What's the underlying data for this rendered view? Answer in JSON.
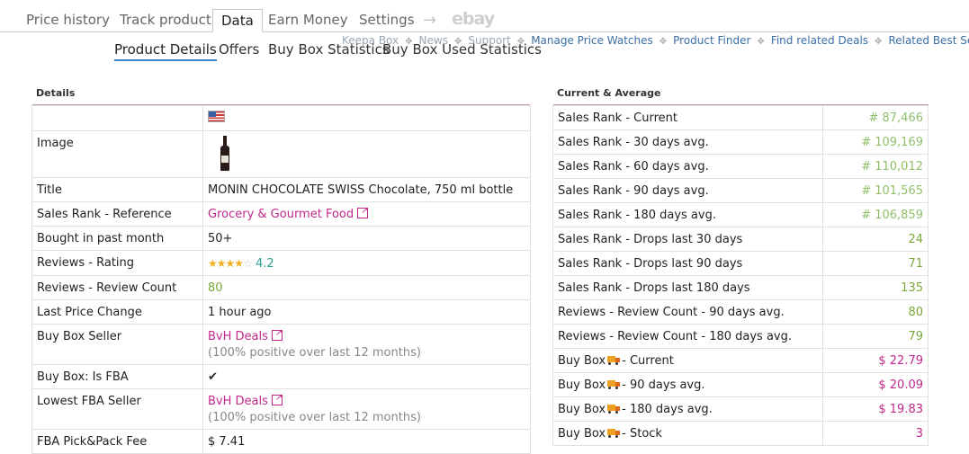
{
  "nav": {
    "tabs": [
      "Price history",
      "Track product",
      "Data",
      "Earn Money",
      "Settings"
    ],
    "arrow": "→",
    "ebay": "ebay"
  },
  "links": [
    "Keepa Box",
    "News",
    "Support",
    "Manage Price Watches",
    "Product Finder",
    "Find related Deals",
    "Related Best Sellers"
  ],
  "subtabs": [
    "Product Details",
    "Offers",
    "Buy Box Statistics",
    "Buy Box Used Statistics"
  ],
  "details": {
    "title": "Details",
    "image_label": "Image",
    "rows": {
      "title_label": "Title",
      "title_value": "MONIN CHOCOLATE SWISS Chocolate, 750 ml bottle",
      "rank_ref_label": "Sales Rank - Reference",
      "rank_ref_value": "Grocery & Gourmet Food",
      "bought_label": "Bought in past month",
      "bought_value": "50+",
      "rating_label": "Reviews - Rating",
      "rating_value": "4.2",
      "review_count_label": "Reviews - Review Count",
      "review_count_value": "80",
      "last_change_label": "Last Price Change",
      "last_change_value": "1 hour ago",
      "bb_seller_label": "Buy Box Seller",
      "bb_seller_value": "BvH Deals",
      "bb_seller_note": "(100% positive over last 12 months)",
      "bb_fba_label": "Buy Box: Is FBA",
      "bb_fba_value": "✔",
      "lowest_fba_label": "Lowest FBA Seller",
      "lowest_fba_value": "BvH Deals",
      "lowest_fba_note": "(100% positive over last 12 months)",
      "fee_label": "FBA Pick&Pack Fee",
      "fee_value": "$ 7.41"
    }
  },
  "current": {
    "title": "Current & Average",
    "rows": [
      {
        "label": "Sales Rank - Current",
        "value": "# 87,466"
      },
      {
        "label": "Sales Rank - 30 days avg.",
        "value": "# 109,169"
      },
      {
        "label": "Sales Rank - 60 days avg.",
        "value": "# 110,012"
      },
      {
        "label": "Sales Rank - 90 days avg.",
        "value": "# 101,565"
      },
      {
        "label": "Sales Rank - 180 days avg.",
        "value": "# 106,859"
      },
      {
        "label": "Sales Rank - Drops last 30 days",
        "value": "24"
      },
      {
        "label": "Sales Rank - Drops last 90 days",
        "value": "71"
      },
      {
        "label": "Sales Rank - Drops last 180 days",
        "value": "135"
      },
      {
        "label": "Reviews - Review Count - 90 days avg.",
        "value": "80"
      },
      {
        "label": "Reviews - Review Count - 180 days avg.",
        "value": "79"
      }
    ],
    "bb_rows": [
      {
        "pre": "Buy Box",
        "post": "- Current",
        "value": "$ 22.79"
      },
      {
        "pre": "Buy Box",
        "post": "- 90 days avg.",
        "value": "$ 20.09"
      },
      {
        "pre": "Buy Box",
        "post": "- 180 days avg.",
        "value": "$ 19.83"
      },
      {
        "pre": "Buy Box",
        "post": "- Stock",
        "value": "3"
      }
    ]
  },
  "colors": {
    "accent": "#c2288a",
    "green": "#7aa83a",
    "link": "#3a6ea5"
  }
}
